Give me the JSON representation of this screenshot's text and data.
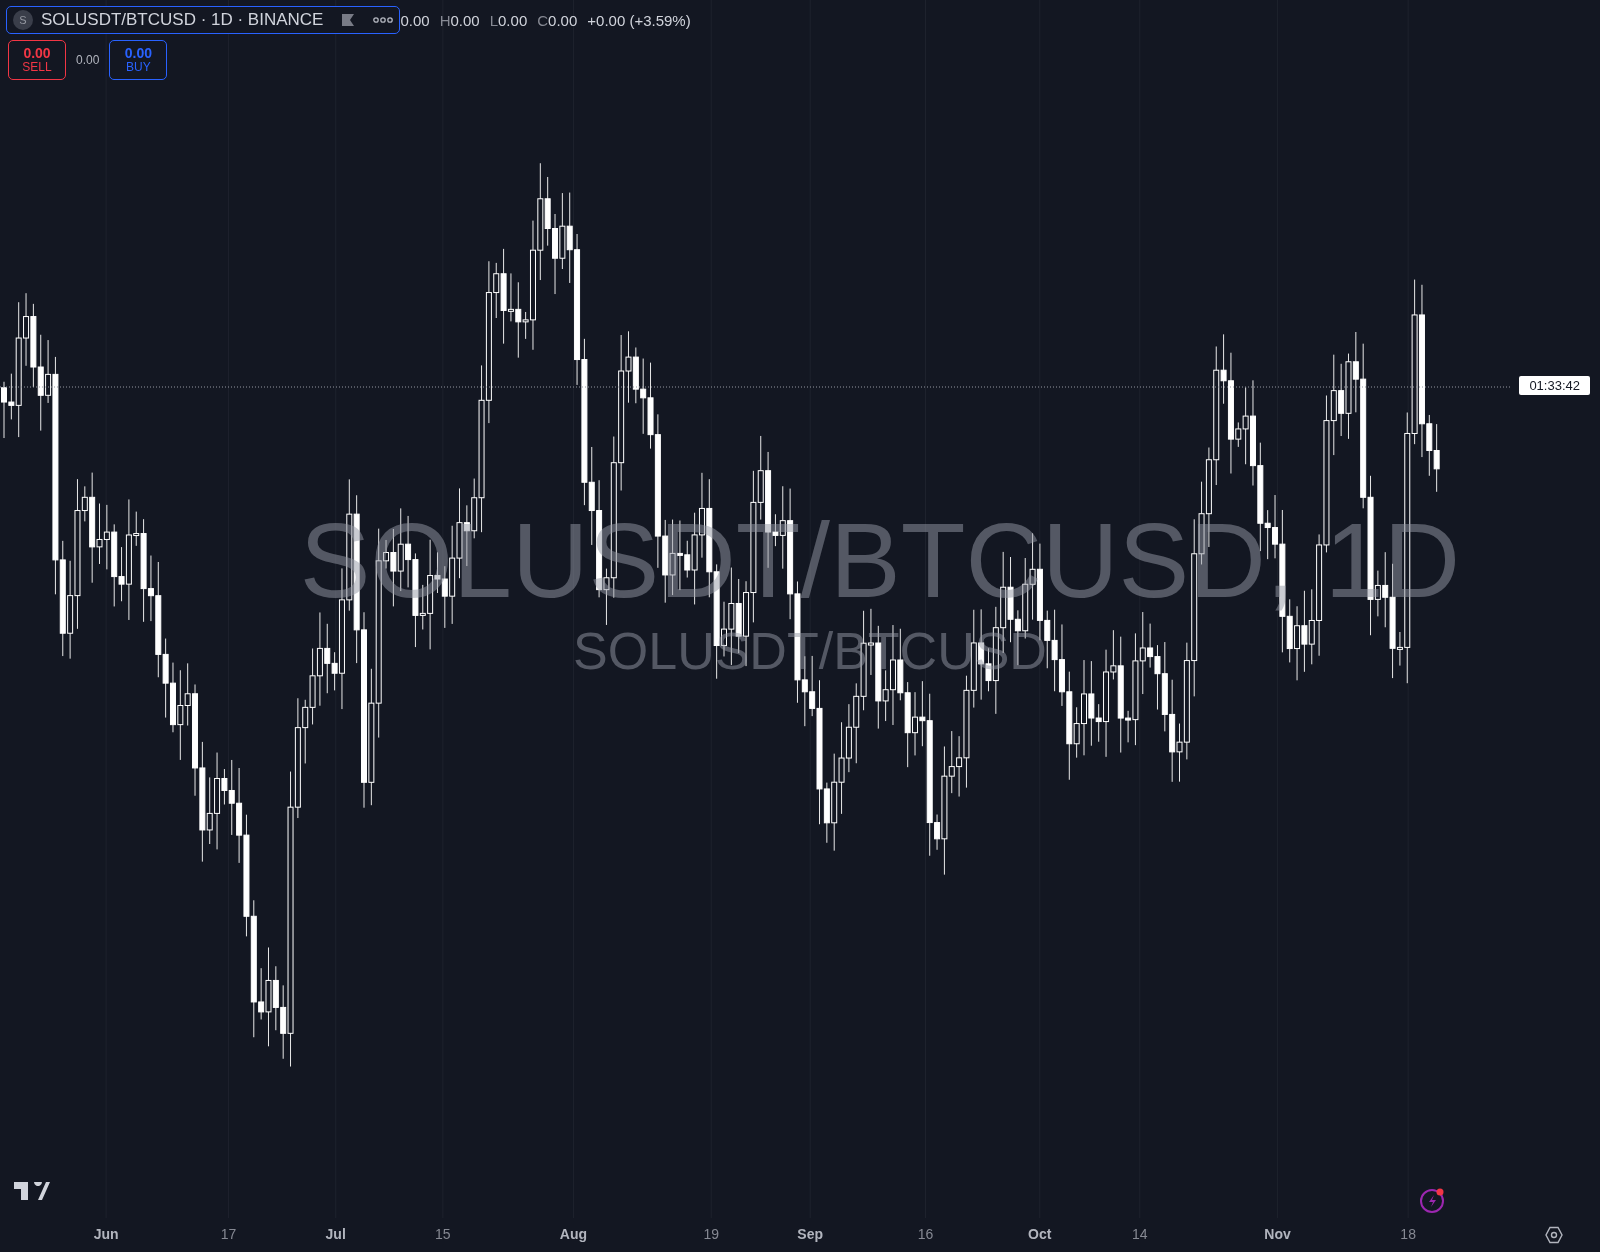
{
  "symbol": {
    "badge": "S",
    "title": "SOLUSDT/BTCUSD · 1D · BINANCE"
  },
  "ohlc": [
    {
      "value": "0.00"
    },
    {
      "label": "H",
      "value": "0.00"
    },
    {
      "label": "L",
      "value": "0.00"
    },
    {
      "label": "C",
      "value": "0.00"
    },
    {
      "value": "+0.00 (+3.59%)"
    }
  ],
  "trade_buttons": [
    {
      "kind": "sell",
      "price": "0.00",
      "label": "SELL"
    },
    {
      "kind": "buy",
      "price": "0.00",
      "label": "BUY"
    }
  ],
  "spread": "0.00",
  "watermark": {
    "title": "SOLUSDT/BTCUSD, 1D",
    "subtitle": "SOLUSDT/BTCUSD"
  },
  "countdown": "01:33:42",
  "time_axis": [
    {
      "label": "Jun",
      "kind": "month"
    },
    {
      "label": "17",
      "kind": "day"
    },
    {
      "label": "Jul",
      "kind": "month"
    },
    {
      "label": "15",
      "kind": "day"
    },
    {
      "label": "Aug",
      "kind": "month"
    },
    {
      "label": "19",
      "kind": "day"
    },
    {
      "label": "Sep",
      "kind": "month"
    },
    {
      "label": "16",
      "kind": "day"
    },
    {
      "label": "Oct",
      "kind": "month"
    },
    {
      "label": "14",
      "kind": "day"
    },
    {
      "label": "Nov",
      "kind": "month"
    },
    {
      "label": "18",
      "kind": "day"
    }
  ]
}
